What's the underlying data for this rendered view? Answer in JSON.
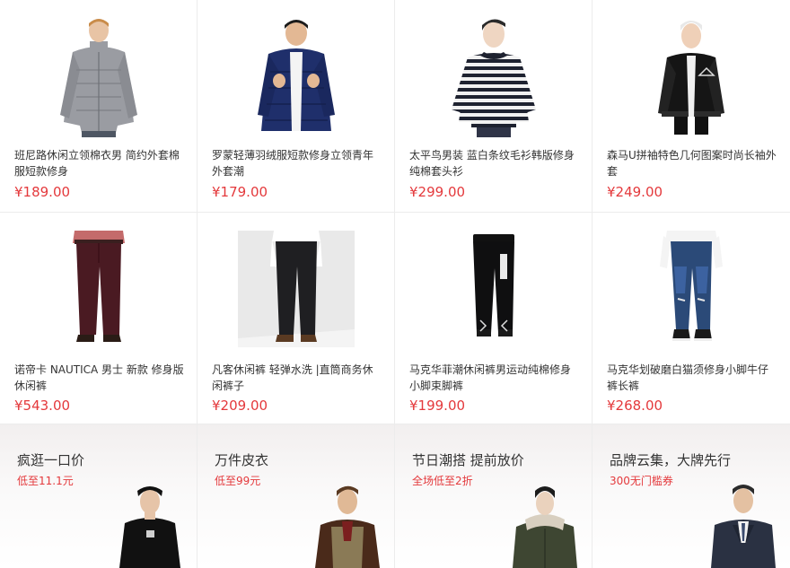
{
  "products": [
    {
      "name": "班尼路休闲立领棉衣男 简约外套棉服短款修身",
      "price": "¥189.00",
      "icon": "gray-puffer-jacket-icon"
    },
    {
      "name": "罗蒙轻薄羽绒服短款修身立领青年外套潮",
      "price": "¥179.00",
      "icon": "navy-down-jacket-icon"
    },
    {
      "name": "太平鸟男装 蓝白条纹毛衫韩版修身纯棉套头衫",
      "price": "¥299.00",
      "icon": "striped-sweater-icon"
    },
    {
      "name": "森马U拼袖特色几何图案时尚长袖外套",
      "price": "¥249.00",
      "icon": "black-bomber-jacket-icon"
    },
    {
      "name": "诺帝卡 NAUTICA 男士 新款 修身版休闲裤",
      "price": "¥543.00",
      "icon": "burgundy-trousers-icon"
    },
    {
      "name": "凡客休闲裤 轻弹水洗 |直筒商务休闲裤子",
      "price": "¥209.00",
      "icon": "black-trousers-icon"
    },
    {
      "name": "马克华菲潮休闲裤男运动纯棉修身小脚束脚裤",
      "price": "¥199.00",
      "icon": "jogger-pants-icon"
    },
    {
      "name": "马克华划破磨白猫须修身小脚牛仔裤长裤",
      "price": "¥268.00",
      "icon": "ripped-jeans-icon"
    }
  ],
  "promos": [
    {
      "title": "疯逛一口价",
      "subtitle": "低至11.1元",
      "icon": "model-black-sweatshirt-icon"
    },
    {
      "title": "万件皮衣",
      "subtitle": "低至99元",
      "icon": "model-leather-vest-icon"
    },
    {
      "title": "节日潮搭 提前放价",
      "subtitle": "全场低至2折",
      "icon": "model-parka-icon"
    },
    {
      "title": "品牌云集，大牌先行",
      "subtitle": "300无门槛券",
      "icon": "model-suit-icon"
    }
  ],
  "colors": {
    "price": "#e4393c",
    "text": "#333333",
    "border": "#ececec"
  }
}
